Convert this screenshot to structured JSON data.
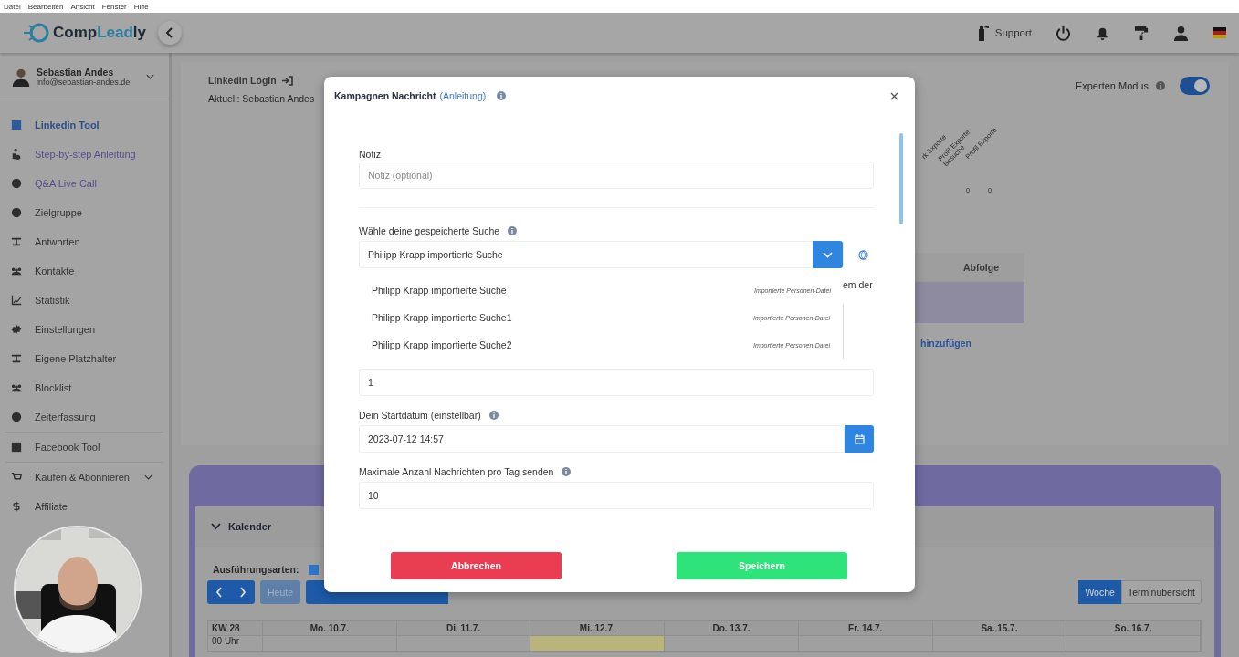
{
  "menu_bar": [
    "Datei",
    "Bearbeiten",
    "Ansicht",
    "Fenster",
    "Hilfe"
  ],
  "header": {
    "logo": [
      {
        "text": "Comp",
        "accent": false
      },
      {
        "text": "Lead",
        "accent": true
      },
      {
        "text": "ly",
        "accent": false
      }
    ],
    "support": "Support"
  },
  "user": {
    "name": "Sebastian Andes",
    "email": "info@sebastian-andes.de"
  },
  "sidebar": {
    "groups": [
      [
        {
          "label": "Linkedin Tool",
          "kind": "nav",
          "selected": true,
          "expandable": false
        },
        {
          "label": "Step-by-step Anleitung",
          "kind": "link",
          "selected": false,
          "expandable": false
        },
        {
          "label": "Q&A Live Call",
          "kind": "link",
          "selected": false,
          "expandable": false
        },
        {
          "label": "Zielgruppe",
          "kind": "nav",
          "selected": false,
          "expandable": false
        },
        {
          "label": "Antworten",
          "kind": "nav",
          "selected": false,
          "expandable": false
        },
        {
          "label": "Kontakte",
          "kind": "nav",
          "selected": false,
          "expandable": false
        },
        {
          "label": "Statistik",
          "kind": "nav",
          "selected": false,
          "expandable": false
        },
        {
          "label": "Einstellungen",
          "kind": "nav",
          "selected": false,
          "expandable": false
        },
        {
          "label": "Eigene Platzhalter",
          "kind": "nav",
          "selected": false,
          "expandable": false
        },
        {
          "label": "Blocklist",
          "kind": "nav",
          "selected": false,
          "expandable": false
        },
        {
          "label": "Zeiterfassung",
          "kind": "nav",
          "selected": false,
          "expandable": false
        }
      ],
      [
        {
          "label": "Facebook Tool",
          "kind": "nav",
          "selected": false,
          "expandable": false
        }
      ],
      [
        {
          "label": "Kaufen & Abonnieren",
          "kind": "nav",
          "selected": false,
          "expandable": true
        },
        {
          "label": "Affiliate",
          "kind": "nav",
          "selected": false,
          "expandable": false
        }
      ]
    ]
  },
  "main": {
    "login": "LinkedIn Login",
    "current": "Aktuell: Sebastian Andes",
    "expert_mode": {
      "label": "Experten Modus",
      "on": true
    },
    "stats": [
      {
        "label": "rk Exporte"
      },
      {
        "label": "Profil Exporte Besuche",
        "value": "0"
      },
      {
        "label": "Profil Exporte",
        "value": "0"
      }
    ],
    "table": {
      "column": "Abfolge",
      "link": "hinzufügen"
    },
    "calendar": {
      "title": "Kalender",
      "expanded": true,
      "legend": {
        "label": "Ausführungsarten:",
        "color": "#2f74c8"
      },
      "today_button": {
        "label": "Heute",
        "disabled": true
      },
      "views": [
        {
          "label": "Woche",
          "selected": true
        },
        {
          "label": "Terminübersicht",
          "selected": false
        }
      ],
      "week": "KW 28",
      "time": "00 Uhr",
      "days": [
        {
          "label": "Mo. 10.7.",
          "today": false
        },
        {
          "label": "Di. 11.7.",
          "today": false
        },
        {
          "label": "Mi. 12.7.",
          "today": true
        },
        {
          "label": "Do. 13.7.",
          "today": false
        },
        {
          "label": "Fr. 14.7.",
          "today": false
        },
        {
          "label": "Sa. 15.7.",
          "today": false
        },
        {
          "label": "So. 16.7.",
          "today": false
        }
      ]
    }
  },
  "modal": {
    "title": "Kampagnen Nachricht",
    "guide_link": "(Anleitung)",
    "note": {
      "label": "Notiz",
      "placeholder": "Notiz (optional)"
    },
    "search": {
      "label": "Wähle deine gespeicherte Suche",
      "value": "Philipp Krapp importierte Suche",
      "behind_text": "em der",
      "options": [
        {
          "label": "Philipp Krapp importierte Suche",
          "tag": "Importierte Personen-Datei"
        },
        {
          "label": "Philipp Krapp importierte Suche1",
          "tag": "Importierte Personen-Datei"
        },
        {
          "label": "Philipp Krapp importierte Suche2",
          "tag": "Importierte Personen-Datei"
        }
      ]
    },
    "count": {
      "value": "1"
    },
    "start": {
      "label": "Dein Startdatum (einstellbar)",
      "value": "2023-07-12 14:57"
    },
    "max": {
      "label": "Maximale Anzahl Nachrichten pro Tag senden",
      "value": "10"
    },
    "cancel": "Abbrechen",
    "save": "Speichern"
  }
}
